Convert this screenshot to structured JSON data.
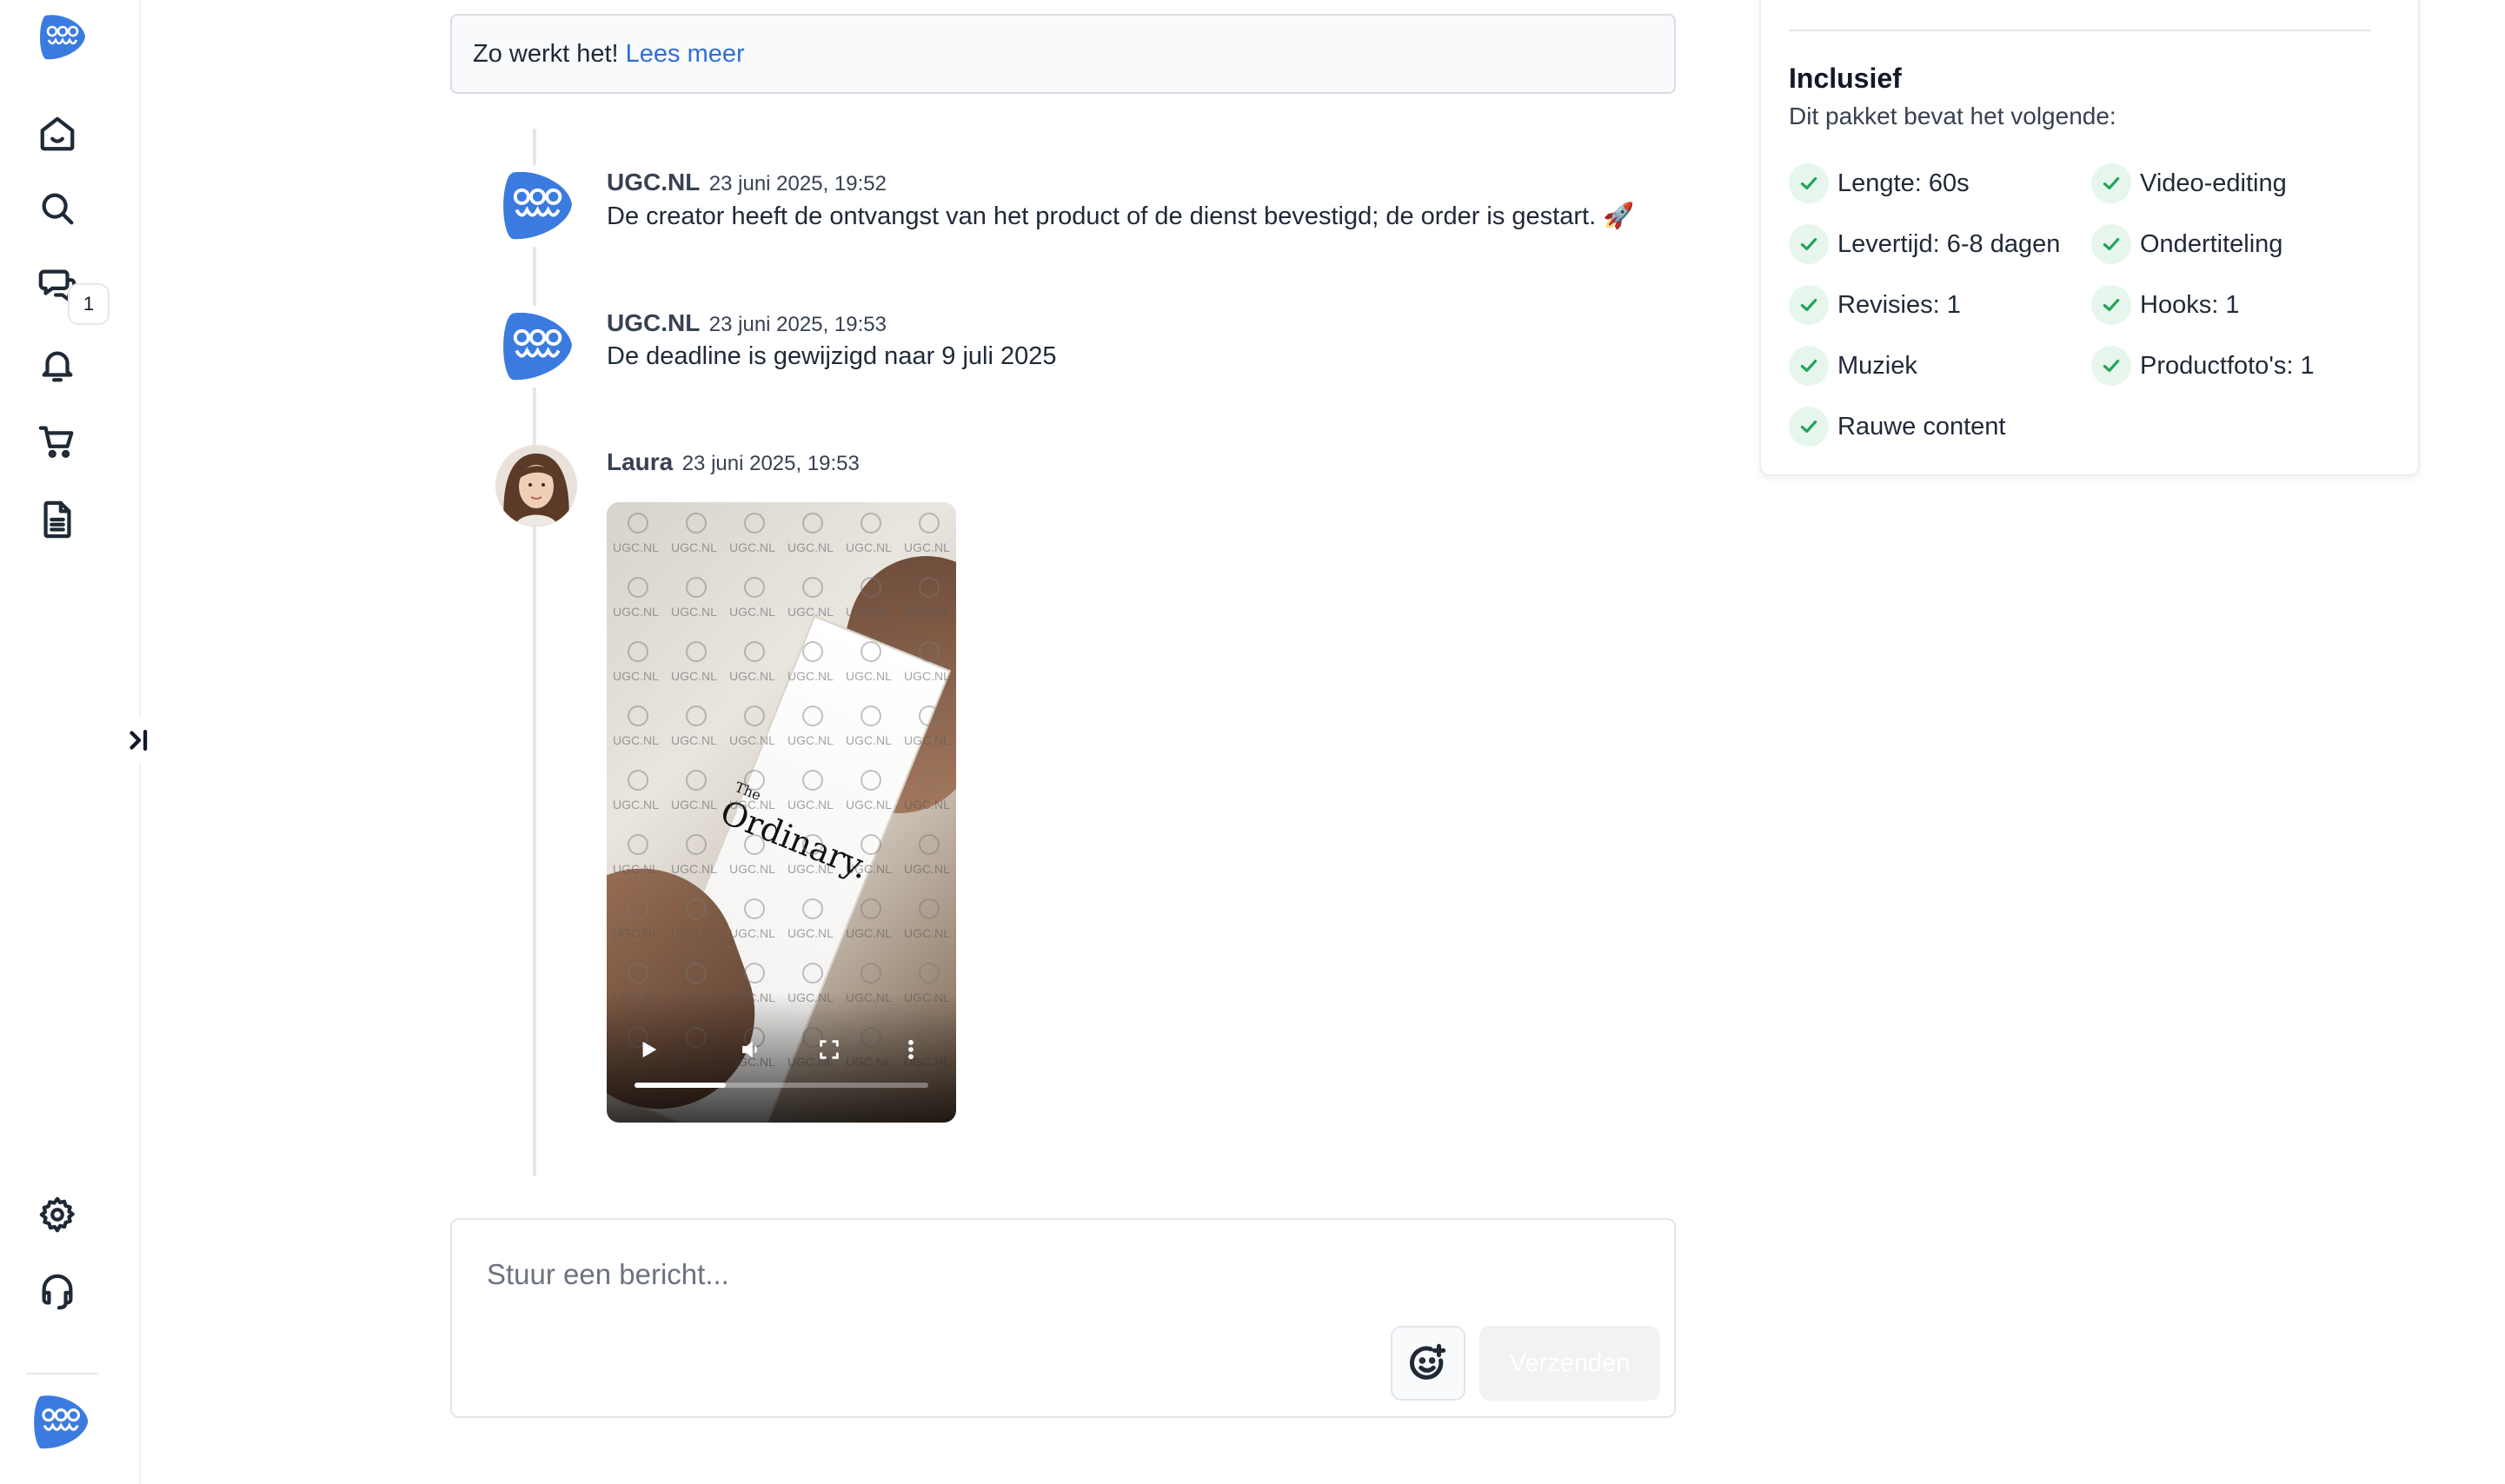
{
  "info": {
    "text": "Zo werkt het!",
    "link": "Lees meer"
  },
  "sidebar": {
    "items": [
      {
        "icon": "home-icon"
      },
      {
        "icon": "search-icon"
      },
      {
        "icon": "chat-icon",
        "badge": "1"
      },
      {
        "icon": "bell-icon"
      },
      {
        "icon": "cart-icon"
      },
      {
        "icon": "document-icon"
      },
      {
        "icon": "gear-icon"
      },
      {
        "icon": "headset-icon"
      }
    ]
  },
  "messages": [
    {
      "sender": "UGC.NL",
      "time": "23 juni 2025, 19:52",
      "text": "De creator heeft de ontvangst van het product of de dienst bevestigd; de order is gestart. 🚀"
    },
    {
      "sender": "UGC.NL",
      "time": "23 juni 2025, 19:53",
      "text": "De deadline is gewijzigd naar 9 juli 2025"
    },
    {
      "sender": "Laura",
      "time": "23 juni 2025, 19:53"
    }
  ],
  "video": {
    "watermark": "UGC.NL",
    "product_brand": "Ordinary.",
    "product_brand_prefix": "The",
    "progress": 0.31
  },
  "composer": {
    "placeholder": "Stuur een bericht...",
    "send_label": "Verzenden"
  },
  "package": {
    "title": "Inclusief",
    "subtitle": "Dit pakket bevat het volgende:",
    "features": [
      "Lengte: 60s",
      "Video-editing",
      "Levertijd: 6-8 dagen",
      "Ondertiteling",
      "Revisies: 1",
      "Hooks: 1",
      "Muziek",
      "Productfoto's: 1",
      "Rauwe content"
    ]
  },
  "colors": {
    "brand": "#3b7be0",
    "link": "#2f6fd6",
    "check": "#22a55a"
  }
}
